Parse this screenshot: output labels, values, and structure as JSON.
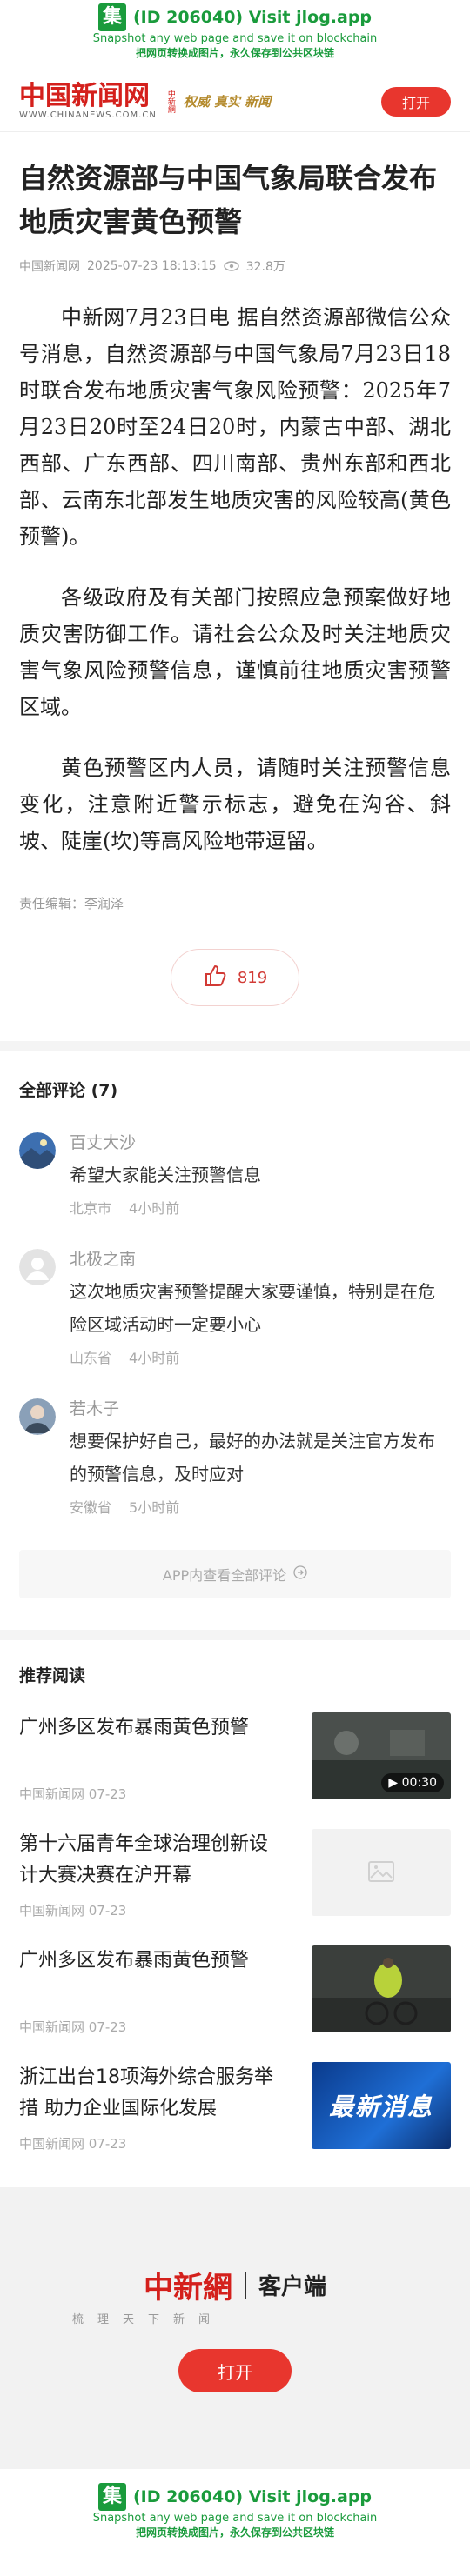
{
  "banner": {
    "logo_glyph": "集",
    "title": "(ID 206040) Visit jlog.app",
    "subtitle_en": "Snapshot any web page and save it on blockchain",
    "subtitle_cn": "把网页转换成图片，永久保存到公共区块链"
  },
  "header": {
    "logo_text": "中国新闻网",
    "logo_small": "中新網",
    "logo_url": "WWW.CHINANEWS.COM.CN",
    "slogan": "权威 真实 新闻",
    "open_label": "打开"
  },
  "article": {
    "title": "自然资源部与中国气象局联合发布地质灾害黄色预警",
    "source": "中国新闻网",
    "datetime": "2025-07-23 18:13:15",
    "views": "32.8万",
    "paragraphs": [
      "中新网7月23日电 据自然资源部微信公众号消息，自然资源部与中国气象局7月23日18时联合发布地质灾害气象风险预警：2025年7月23日20时至24日20时，内蒙古中部、湖北西部、广东西部、四川南部、贵州东部和西北部、云南东北部发生地质灾害的风险较高(黄色预警)。",
      "各级政府及有关部门按照应急预案做好地质灾害防御工作。请社会公众及时关注地质灾害气象风险预警信息，谨慎前往地质灾害预警区域。",
      "黄色预警区内人员，请随时关注预警信息变化，注意附近警示标志，避免在沟谷、斜坡、陡崖(坎)等高风险地带逗留。"
    ],
    "editor": "责任编辑：李润泽",
    "likes": "819"
  },
  "comments": {
    "title": "全部评论 (7)",
    "items": [
      {
        "name": "百丈大沙",
        "text": "希望大家能关注预警信息",
        "location": "北京市",
        "time": "4小时前"
      },
      {
        "name": "北极之南",
        "text": "这次地质灾害预警提醒大家要谨慎，特别是在危险区域活动时一定要小心",
        "location": "山东省",
        "time": "4小时前"
      },
      {
        "name": "若木子",
        "text": "想要保护好自己，最好的办法就是关注官方发布的预警信息，及时应对",
        "location": "安徽省",
        "time": "5小时前"
      }
    ],
    "more_label": "APP内查看全部评论"
  },
  "recommend": {
    "title": "推荐阅读",
    "items": [
      {
        "title": "广州多区发布暴雨黄色预警",
        "meta": "中国新闻网 07-23",
        "video_duration": "00:30"
      },
      {
        "title": "第十六届青年全球治理创新设计大赛决赛在沪开幕",
        "meta": "中国新闻网 07-23"
      },
      {
        "title": "广州多区发布暴雨黄色预警",
        "meta": "中国新闻网 07-23"
      },
      {
        "title": "浙江出台18项海外综合服务举措 助力企业国际化发展",
        "meta": "中国新闻网 07-23",
        "thumb_text": "最新消息"
      }
    ]
  },
  "app_promo": {
    "logo_text": "中新網",
    "client_label": "客户端",
    "slogan": "梳理天下新闻",
    "open_label": "打开"
  },
  "colors": {
    "brand_red": "#e8362e",
    "banner_green": "#1a9b3c"
  }
}
